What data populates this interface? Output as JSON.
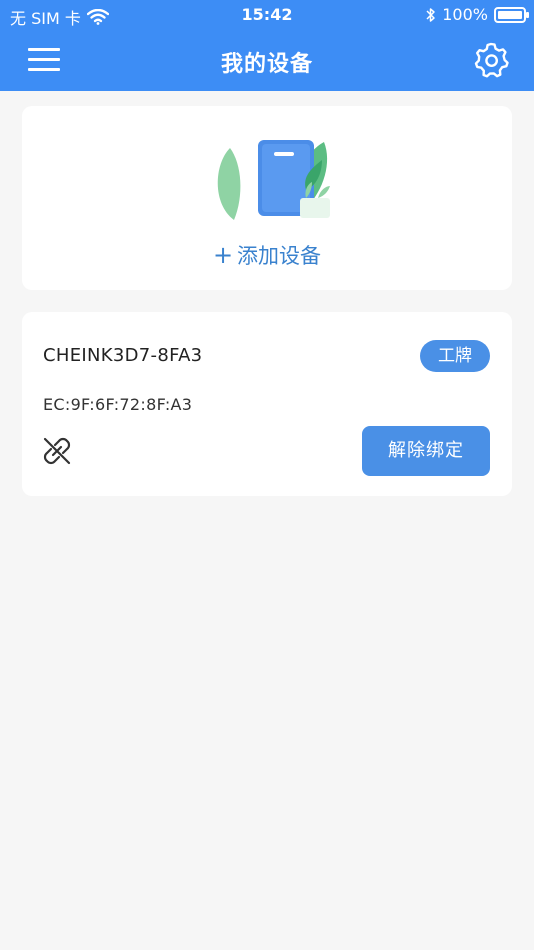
{
  "status_bar": {
    "carrier": "无 SIM 卡",
    "time": "15:42",
    "battery": "100%"
  },
  "nav": {
    "title": "我的设备",
    "menu_icon": "menu-icon",
    "settings_icon": "gear-icon"
  },
  "add_device": {
    "plus": "+",
    "label": "添加设备"
  },
  "device": {
    "name": "CHEINK3D7-8FA3",
    "type": "工牌",
    "mac": "EC:9F:6F:72:8F:A3",
    "unbind_label": "解除绑定",
    "unlink_icon": "unlink-icon"
  },
  "colors": {
    "accent": "#3d8df5",
    "button": "#4a90e6",
    "link_text": "#3a82ce",
    "background": "#f6f6f6"
  }
}
